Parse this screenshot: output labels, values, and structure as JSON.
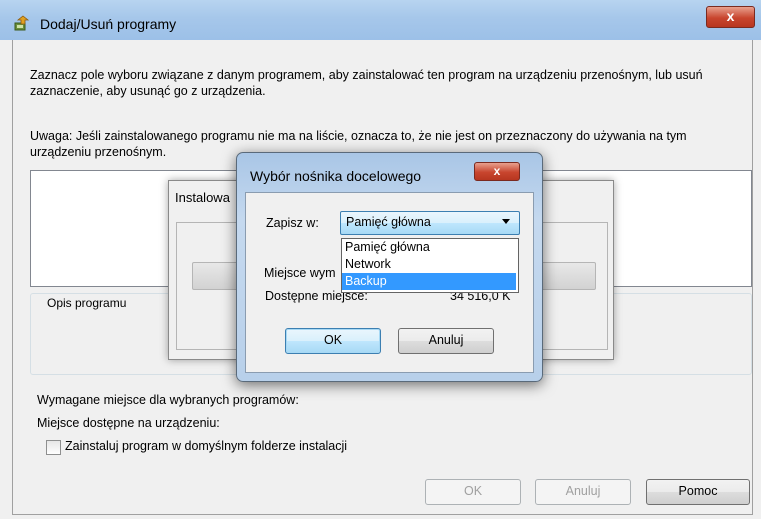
{
  "window": {
    "title": "Dodaj/Usuń programy",
    "close_label": "x",
    "instructions": "Zaznacz pole wyboru związane z danym programem, aby zainstalować ten program na urządzeniu przenośnym, lub usuń zaznaczenie, aby usunąć go z urządzenia.",
    "warning": "Uwaga: Jeśli zainstalowanego programu nie ma na liście, oznacza to, że nie jest on przeznaczony do używania na tym urządzeniu przenośnym.",
    "description_group_label": "Opis programu",
    "required_space_label": "Wymagane miejsce dla wybranych programów:",
    "available_space_label": "Miejsce dostępne na urządzeniu:",
    "checkbox_label": "Zainstaluj program w domyślnym folderze instalacji",
    "checkbox_checked": false,
    "buttons": {
      "ok": "OK",
      "cancel": "Anuluj",
      "help": "Pomoc"
    }
  },
  "install_dialog": {
    "title_partial": "Instalowa"
  },
  "target_dialog": {
    "title": "Wybór nośnika docelowego",
    "close_label": "x",
    "save_in_label": "Zapisz w:",
    "save_in_value": "Pamięć główna",
    "dropdown_options": [
      "Pamięć główna",
      "Network",
      "Backup"
    ],
    "selected_option_index": 2,
    "required_label_partial": "Miejsce wym",
    "available_label": "Dostępne miejsce:",
    "available_value": "34 516,0 K",
    "buttons": {
      "ok": "OK",
      "cancel": "Anuluj"
    }
  },
  "colors": {
    "titlebar": "#a6c7ea",
    "close_red": "#c8452e",
    "selection": "#3399ff",
    "focus_button": "#bee6fd"
  }
}
